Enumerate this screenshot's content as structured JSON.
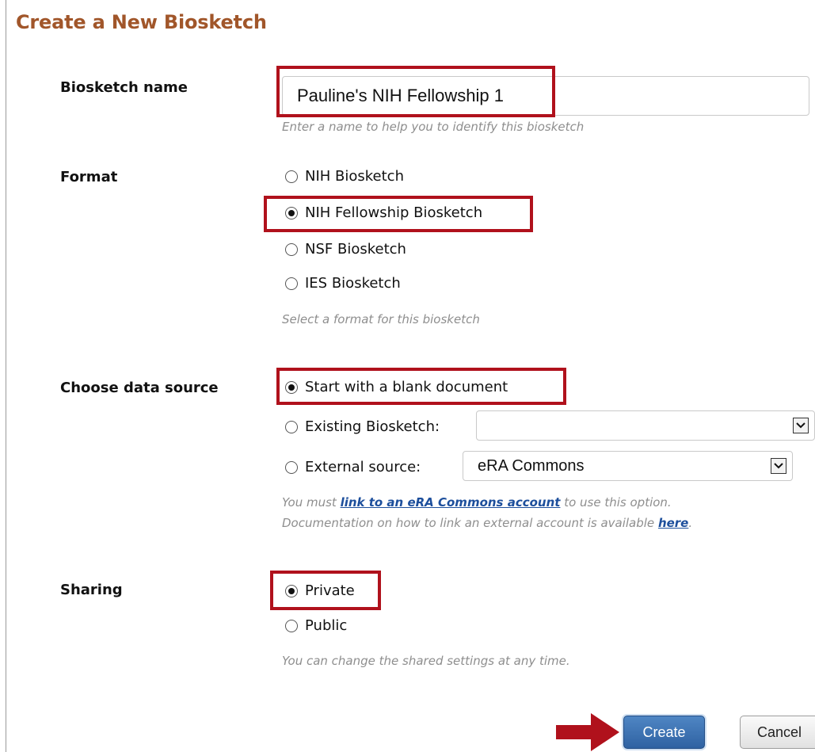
{
  "dialog": {
    "title": "Create a New Biosketch"
  },
  "name": {
    "label": "Biosketch name",
    "value": "Pauline's NIH Fellowship 1",
    "hint": "Enter a name to help you to identify this biosketch"
  },
  "format": {
    "label": "Format",
    "options": [
      {
        "label": "NIH Biosketch",
        "selected": false
      },
      {
        "label": "NIH Fellowship Biosketch",
        "selected": true
      },
      {
        "label": "NSF Biosketch",
        "selected": false
      },
      {
        "label": "IES Biosketch",
        "selected": false
      }
    ],
    "hint": "Select a format for this biosketch"
  },
  "data_source": {
    "label": "Choose data source",
    "options": [
      {
        "label": "Start with a blank document",
        "selected": true
      },
      {
        "label": "Existing Biosketch:",
        "selected": false
      },
      {
        "label": "External source:",
        "selected": false
      }
    ],
    "existing_select_value": "",
    "external_select_value": "eRA Commons",
    "hint_line1_pre": "You must ",
    "hint_line1_link": "link to an eRA Commons account",
    "hint_line1_post": " to use this option.",
    "hint_line2_pre": "Documentation on how to link an external account is available ",
    "hint_line2_link": "here",
    "hint_line2_post": "."
  },
  "sharing": {
    "label": "Sharing",
    "options": [
      {
        "label": "Private",
        "selected": true
      },
      {
        "label": "Public",
        "selected": false
      }
    ],
    "hint": "You can change the shared settings at any time."
  },
  "actions": {
    "create_label": "Create",
    "cancel_label": "Cancel"
  },
  "colors": {
    "title": "#a1562a",
    "highlight": "#b0111c",
    "primary_button": "#3a6fb0"
  },
  "icons": {
    "select_arrow": "chevron-down-icon",
    "pointer": "red-arrow-icon"
  }
}
